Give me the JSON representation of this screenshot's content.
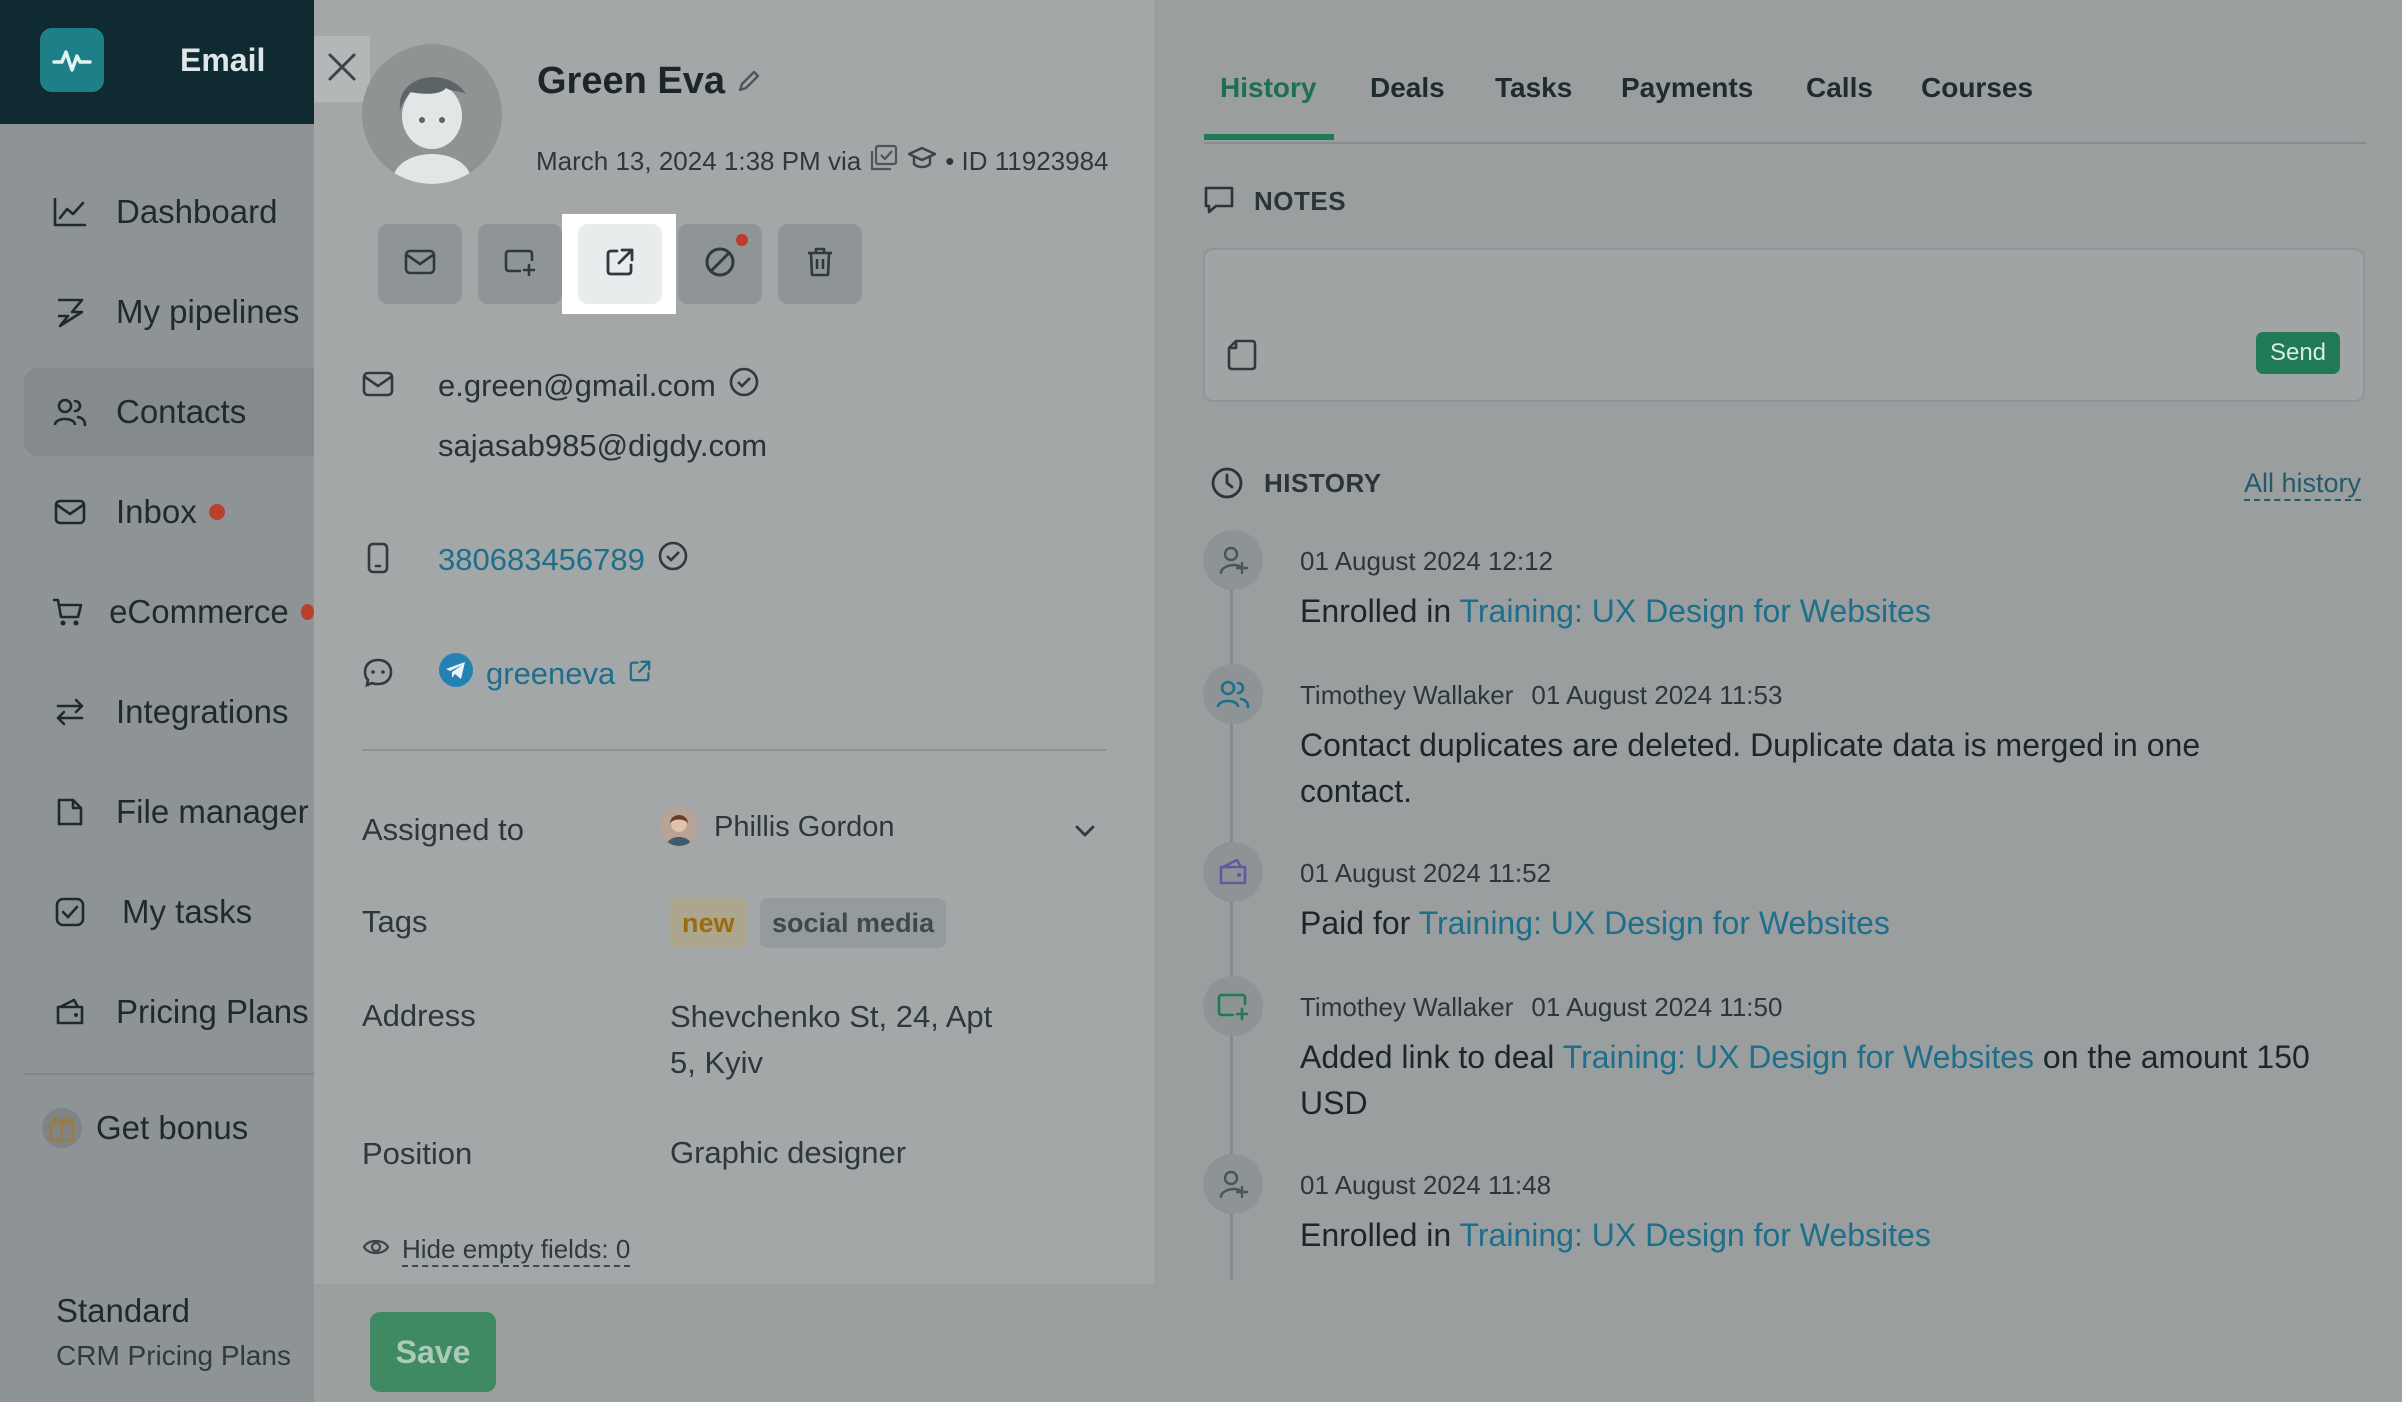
{
  "sidebar": {
    "app_title": "Email",
    "items": [
      {
        "label": "Dashboard",
        "icon": "chart-line-icon"
      },
      {
        "label": "My pipelines",
        "icon": "pipeline-icon"
      },
      {
        "label": "Contacts",
        "icon": "users-icon"
      },
      {
        "label": "Inbox",
        "icon": "mail-icon"
      },
      {
        "label": "eCommerce",
        "icon": "cart-icon"
      },
      {
        "label": "Integrations",
        "icon": "swap-arrows-icon"
      },
      {
        "label": "File manager",
        "icon": "file-icon"
      },
      {
        "label": "My tasks",
        "icon": "checkbox-icon"
      },
      {
        "label": "Pricing Plans",
        "icon": "wallet-icon"
      },
      {
        "label": "Get bonus",
        "icon": "gift-icon"
      }
    ],
    "plan_name": "Standard",
    "plan_sub": "CRM Pricing Plans"
  },
  "contact": {
    "name": "Green Eva",
    "meta_date": "March 13, 2024 1:38 PM via",
    "meta_id": "• ID 11923984",
    "emails": [
      "e.green@gmail.com",
      "sajasab985@digdy.com"
    ],
    "phone": "380683456789",
    "telegram": "greeneva",
    "fields": {
      "assigned_label": "Assigned to",
      "assigned_value": "Phillis Gordon",
      "tags_label": "Tags",
      "tags": [
        "new",
        "social media"
      ],
      "address_label": "Address",
      "address_line1": "Shevchenko St, 24, Apt",
      "address_line2": "5, Kyiv",
      "position_label": "Position",
      "position_value": "Graphic designer"
    },
    "hide_empty": "Hide empty fields: 0",
    "save_label": "Save"
  },
  "tabs": [
    "History",
    "Deals",
    "Tasks",
    "Payments",
    "Calls",
    "Courses"
  ],
  "notes": {
    "title": "NOTES",
    "send_label": "Send"
  },
  "history": {
    "title": "HISTORY",
    "all_link": "All history",
    "events": [
      {
        "who": "",
        "time": "01 August 2024 12:12",
        "pre": "Enrolled in ",
        "link": "Training: UX Design for Websites",
        "post": ""
      },
      {
        "who": "Timothey Wallaker",
        "time": "01 August 2024 11:53",
        "pre": "Contact duplicates are deleted. Duplicate data is merged in one contact.",
        "link": "",
        "post": ""
      },
      {
        "who": "",
        "time": "01 August 2024 11:52",
        "pre": "Paid for ",
        "link": "Training: UX Design for Websites",
        "post": ""
      },
      {
        "who": "Timothey Wallaker",
        "time": "01 August 2024 11:50",
        "pre": "Added link to deal ",
        "link": "Training: UX Design for Websites",
        "post": " on the amount 150 USD"
      },
      {
        "who": "",
        "time": "01 August 2024 11:48",
        "pre": "Enrolled in ",
        "link": "Training: UX Design for Websites",
        "post": ""
      }
    ]
  },
  "colors": {
    "accent": "#1f7a55",
    "link": "#1d6f8c",
    "sidebar_top": "#0f2a30"
  }
}
